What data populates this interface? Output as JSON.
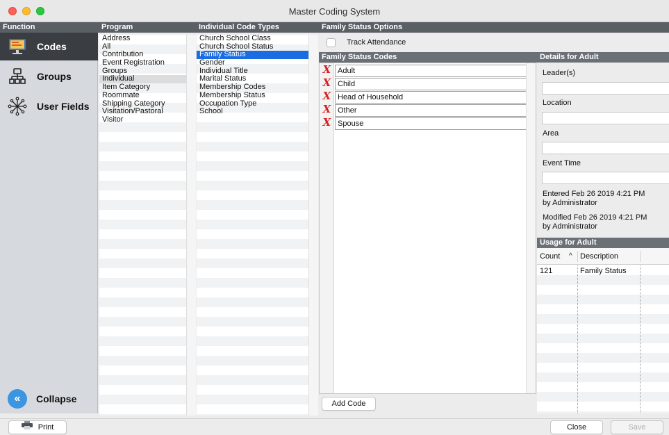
{
  "window": {
    "title": "Master Coding System"
  },
  "headers": {
    "function": "Function",
    "program": "Program",
    "code_types": "Individual Code Types",
    "options": "Family Status Options",
    "codes": "Family Status Codes",
    "details": "Details for Adult",
    "usage": "Usage for Adult"
  },
  "function_menu": {
    "items": [
      {
        "label": "Codes",
        "icon": "monitor-icon",
        "active": true
      },
      {
        "label": "Groups",
        "icon": "hierarchy-icon",
        "active": false
      },
      {
        "label": "User Fields",
        "icon": "network-icon",
        "active": false
      }
    ],
    "collapse_label": "Collapse",
    "collapse_icon": "double-chevron-left-icon"
  },
  "program_list": {
    "items": [
      "Address",
      "All",
      "Contribution",
      "Event Registration",
      "Groups",
      "Individual",
      "Item Category",
      "Roommate",
      "Shipping Category",
      "Visitation/Pastoral",
      "Visitor"
    ],
    "selected": "Individual"
  },
  "code_types_list": {
    "items": [
      "Church School Class",
      "Church School Status",
      "Family Status",
      "Gender",
      "Individual Title",
      "Marital Status",
      "Membership Codes",
      "Membership Status",
      "Occupation Type",
      "School"
    ],
    "selected": "Family Status"
  },
  "options": {
    "track_attendance_label": "Track Attendance",
    "track_attendance_checked": false
  },
  "codes": {
    "items": [
      "Adult",
      "Child",
      "Head of Household",
      "Other",
      "Spouse"
    ],
    "add_button": "Add Code",
    "delete_icon": "delete-x-icon"
  },
  "details": {
    "leader_label": "Leader(s)",
    "location_label": "Location",
    "area_label": "Area",
    "event_time_label": "Event Time",
    "entered_line": "Entered Feb 26 2019 4:21 PM",
    "entered_by": "by Administrator",
    "modified_line": "Modified Feb 26 2019 4:21 PM",
    "modified_by": "by Administrator"
  },
  "usage": {
    "columns": {
      "count": "Count",
      "sort_glyph": "^",
      "description": "Description"
    },
    "rows": [
      {
        "count": "121",
        "description": "Family Status"
      }
    ]
  },
  "footer": {
    "print_label": "Print",
    "close_label": "Close",
    "save_label": "Save"
  },
  "colors": {
    "header_bg": "#5a5f66",
    "selection_blue": "#1a6ce0",
    "delete_red": "#d62222",
    "collapse_blue": "#3b95e0"
  }
}
